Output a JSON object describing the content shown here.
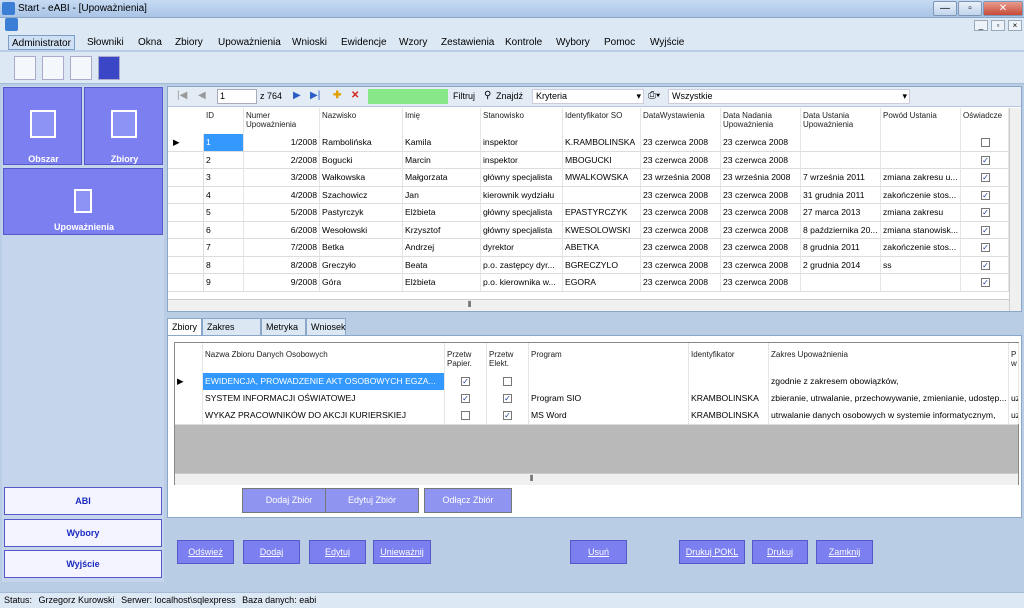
{
  "window": {
    "title": "Start - eABI - [Upoważnienia]",
    "minimize": "—",
    "maximize": "▫",
    "close": "✕"
  },
  "menu": [
    "Administrator",
    "Słowniki",
    "Okna",
    "Zbiory",
    "Upoważnienia",
    "Wnioski",
    "Ewidencje",
    "Wzory",
    "Zestawienia",
    "Kontrole",
    "Wybory",
    "Pomoc",
    "Wyjście"
  ],
  "sidebar": {
    "tiles": [
      "Obszar",
      "Zbiory",
      "Upoważnienia"
    ],
    "buttons": [
      "ABI",
      "Wybory",
      "Wyjście"
    ]
  },
  "navigator": {
    "position": "1",
    "count": "z 764",
    "filter": "Filtruj",
    "find": "Znajdź",
    "criteria": "Kryteria",
    "scope": "Wszystkie"
  },
  "grid1": {
    "columns": [
      "ID",
      "Numer Upoważnienia",
      "Nazwisko",
      "Imię",
      "Stanowisko",
      "Identyfikator SO",
      "DataWystawienia",
      "Data Nadania Upoważnienia",
      "Data Ustania Upoważnienia",
      "Powód Ustania",
      "Oświadcze"
    ],
    "rows": [
      {
        "id": "1",
        "num": "1/2008",
        "nazw": "Rambolińska",
        "imie": "Kamila",
        "stan": "inspektor",
        "ident": "K.RAMBOLINSKA",
        "wyst": "23 czerwca 2008",
        "nad": "23 czerwca 2008",
        "ust": "",
        "powod": "",
        "osw": false
      },
      {
        "id": "2",
        "num": "2/2008",
        "nazw": "Bogucki",
        "imie": "Marcin",
        "stan": "inspektor",
        "ident": "MBOGUCKI",
        "wyst": "23 czerwca 2008",
        "nad": "23 czerwca 2008",
        "ust": "",
        "powod": "",
        "osw": true
      },
      {
        "id": "3",
        "num": "3/2008",
        "nazw": "Wałkowska",
        "imie": "Małgorzata",
        "stan": "główny specjalista",
        "ident": "MWALKOWSKA",
        "wyst": "23 września 2008",
        "nad": "23 września 2008",
        "ust": "7 września 2011",
        "powod": "zmiana zakresu u...",
        "osw": true
      },
      {
        "id": "4",
        "num": "4/2008",
        "nazw": "Szachowicz",
        "imie": "Jan",
        "stan": "kierownik wydziału",
        "ident": "",
        "wyst": "23 czerwca 2008",
        "nad": "23 czerwca 2008",
        "ust": "31 grudnia 2011",
        "powod": "zakończenie stos...",
        "osw": true
      },
      {
        "id": "5",
        "num": "5/2008",
        "nazw": "Pastyrczyk",
        "imie": "Elżbieta",
        "stan": "główny specjalista",
        "ident": "EPASTYRCZYK",
        "wyst": "23 czerwca 2008",
        "nad": "23 czerwca 2008",
        "ust": "27 marca 2013",
        "powod": "zmiana zakresu",
        "osw": true
      },
      {
        "id": "6",
        "num": "6/2008",
        "nazw": "Wesołowski",
        "imie": "Krzysztof",
        "stan": "główny specjalista",
        "ident": "KWESOLOWSKI",
        "wyst": "23 czerwca 2008",
        "nad": "23 czerwca 2008",
        "ust": "8 października 20...",
        "powod": "zmiana stanowisk...",
        "osw": true
      },
      {
        "id": "7",
        "num": "7/2008",
        "nazw": "Betka",
        "imie": "Andrzej",
        "stan": "dyrektor",
        "ident": "ABETKA",
        "wyst": "23 czerwca 2008",
        "nad": "23 czerwca 2008",
        "ust": "8 grudnia 2011",
        "powod": "zakończenie stos...",
        "osw": true
      },
      {
        "id": "8",
        "num": "8/2008",
        "nazw": "Greczyło",
        "imie": "Beata",
        "stan": "p.o. zastępcy dyr...",
        "ident": "BGRECZYLO",
        "wyst": "23 czerwca 2008",
        "nad": "23 czerwca 2008",
        "ust": "2 grudnia 2014",
        "powod": "ss",
        "osw": true
      },
      {
        "id": "9",
        "num": "9/2008",
        "nazw": "Góra",
        "imie": "Elżbieta",
        "stan": "p.o. kierownika w...",
        "ident": "EGORA",
        "wyst": "23 czerwca 2008",
        "nad": "23 czerwca 2008",
        "ust": "",
        "powod": "",
        "osw": true
      }
    ]
  },
  "tabs": [
    "Zbiory",
    "Zakres Upow.",
    "Metryka",
    "Wniosek"
  ],
  "grid2": {
    "columns": [
      "Nazwa Zbioru Danych Osobowych",
      "Przetw Papier.",
      "Przetw Elekt.",
      "Program",
      "Identyfikator",
      "Zakres Upoważnienia",
      "P w"
    ],
    "rows": [
      {
        "nazwa": "EWIDENCJA, PROWADZENIE AKT OSOBOWYCH EGZA...",
        "pap": true,
        "elek": false,
        "prog": "",
        "ident": "",
        "zakres": "zgodnie z zakresem obowiązków,",
        "p": ""
      },
      {
        "nazwa": "SYSTEM INFORMACJI OŚWIATOWEJ",
        "pap": true,
        "elek": true,
        "prog": "Program SIO",
        "ident": "KRAMBOLINSKA",
        "zakres": "zbieranie, utrwalanie, przechowywanie, zmienianie, udostęp...",
        "p": "uz"
      },
      {
        "nazwa": "WYKAZ PRACOWNIKÓW DO AKCJI KURIERSKIEJ",
        "pap": false,
        "elek": true,
        "prog": "MS Word",
        "ident": "KRAMBOLINSKA",
        "zakres": "utrwalanie danych osobowych w systemie informatycznym,",
        "p": "uz"
      }
    ],
    "buttons": [
      "Dodaj Zbiór",
      "Edytuj Zbiór",
      "Odłącz Zbiór"
    ]
  },
  "bottom_buttons": [
    "Odśwież",
    "Dodaj",
    "Edytuj",
    "Unieważnij",
    "Usuń",
    "Drukuj POKL",
    "Drukuj",
    "Zamknij"
  ],
  "status": {
    "label": "Status:",
    "user": "Grzegorz Kurowski",
    "server": "Serwer: localhost\\sqlexpress",
    "db": "Baza danych: eabi"
  }
}
